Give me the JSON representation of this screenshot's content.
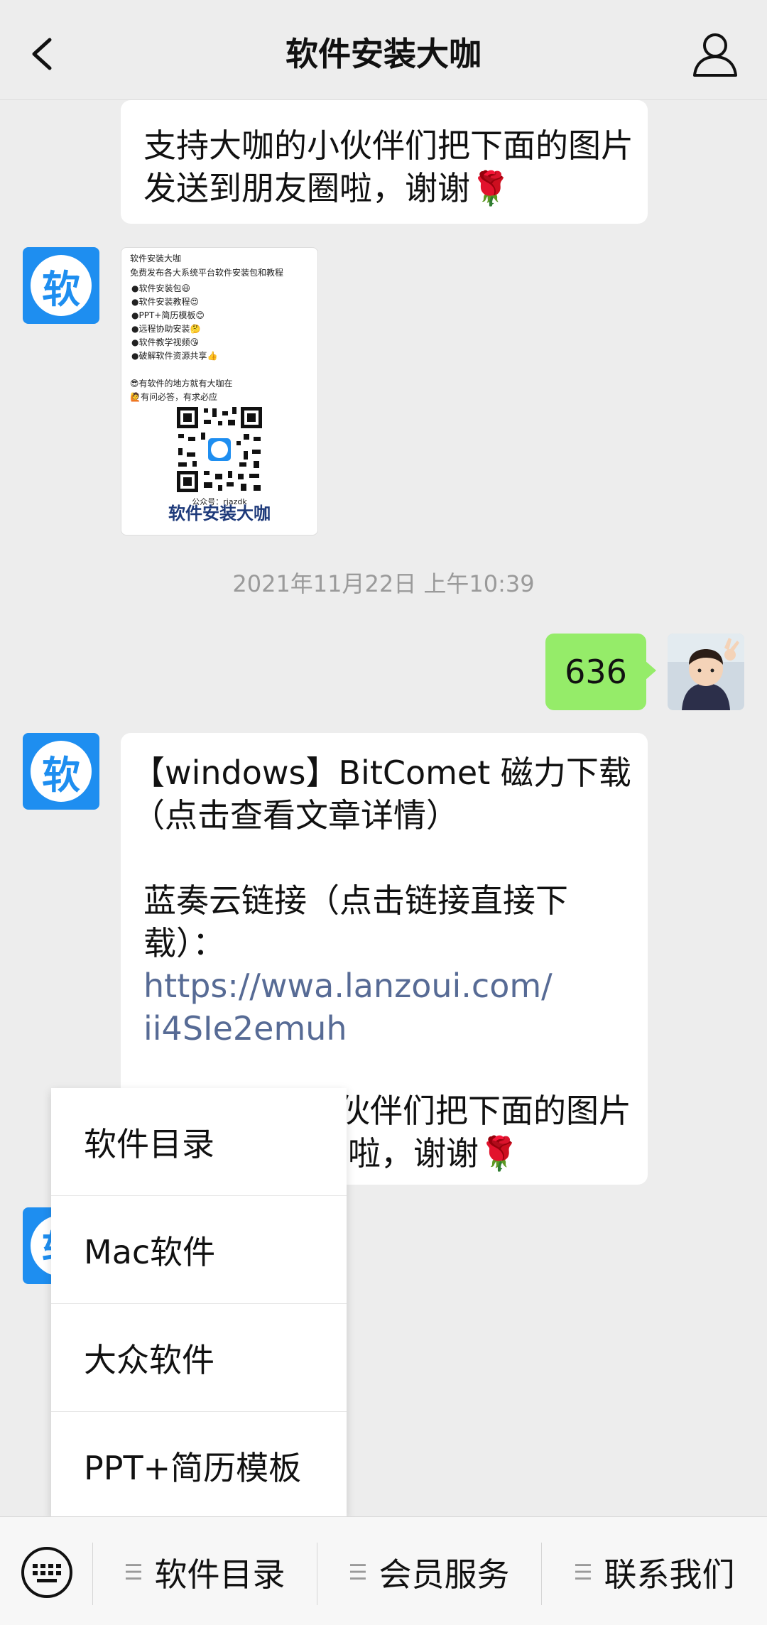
{
  "header": {
    "title": "软件安装大咖",
    "back_icon": "chevron-left-icon",
    "profile_icon": "person-icon"
  },
  "messages": {
    "msg1_lines": [
      "支持大咖的小伙伴们把下面的图片",
      "发送到朋友圈啦，谢谢🌹"
    ],
    "service_avatar_char": "软",
    "poster": {
      "title": "软件安装大咖",
      "subtitle": "免费发布各大系统平台软件安装包和教程",
      "items": [
        "●软件安装包😃",
        "●软件安装教程😍",
        "●PPT+简历模板😊",
        "●远程协助安装🤔",
        "●软件教学视频😘",
        "●破解软件资源共享👍"
      ],
      "slogan_lines": [
        "😎有软件的地方就有大咖在",
        "🙋有问必答，有求必应"
      ],
      "account": "公众号：rjazdk",
      "brand": "软件安装大咖"
    },
    "timestamp": "2021年11月22日 上午10:39",
    "outgoing_text": "636",
    "article": {
      "line1": "【windows】BitComet 磁力下载",
      "line2": "（点击查看文章详情）",
      "line3": "蓝奏云链接（点击链接直接下",
      "line4": "载）：",
      "link_line1": "https://wwa.lanzoui.com/",
      "link_line2": "ii4SIe2emuh",
      "tail_line1": "伙伴们把下面的图片",
      "tail_line2": "啦，谢谢🌹"
    }
  },
  "dropdown": {
    "items": [
      "软件目录",
      "Mac软件",
      "大众软件",
      "PPT+简历模板"
    ]
  },
  "bottom_menu": {
    "keyboard_icon": "keyboard-icon",
    "menu_icon": "menu-icon",
    "buttons": [
      "软件目录",
      "会员服务",
      "联系我们"
    ]
  },
  "colors": {
    "accent_blue": "#1e8ef0",
    "outgoing_bubble": "#95ec69",
    "link": "#576b95"
  }
}
